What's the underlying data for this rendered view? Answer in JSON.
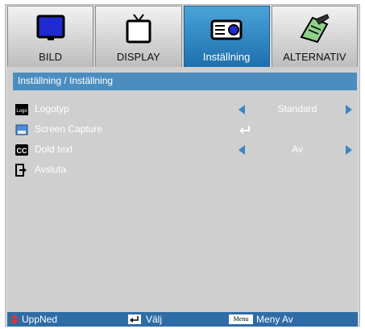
{
  "tabs": [
    {
      "label": "BILD",
      "icon": "monitor-icon",
      "active": false
    },
    {
      "label": "DISPLAY",
      "icon": "tv-icon",
      "active": false
    },
    {
      "label": "Inställning",
      "icon": "projector-icon",
      "active": true
    },
    {
      "label": "ALTERNATIV",
      "icon": "notepad-pen-icon",
      "active": false
    }
  ],
  "section_title": "Inställning / Inställning",
  "rows": [
    {
      "label": "Logotyp",
      "value": "Standard",
      "icon": "logo-icon"
    },
    {
      "label": "Screen Capture",
      "value": "",
      "icon": "screen-capture-icon"
    },
    {
      "label": "Dold text",
      "value": "Av",
      "icon": "cc-icon"
    },
    {
      "label": "Avsluta",
      "value": "",
      "icon": "exit-icon"
    }
  ],
  "footer": {
    "updown": "UppNed",
    "select": "Välj",
    "menu_key": "Menu",
    "menu_off": "Meny Av"
  },
  "colors": {
    "accent": "#4c8dbf",
    "active_tab": "#2f7fc0",
    "footer": "#2f6ca5"
  }
}
